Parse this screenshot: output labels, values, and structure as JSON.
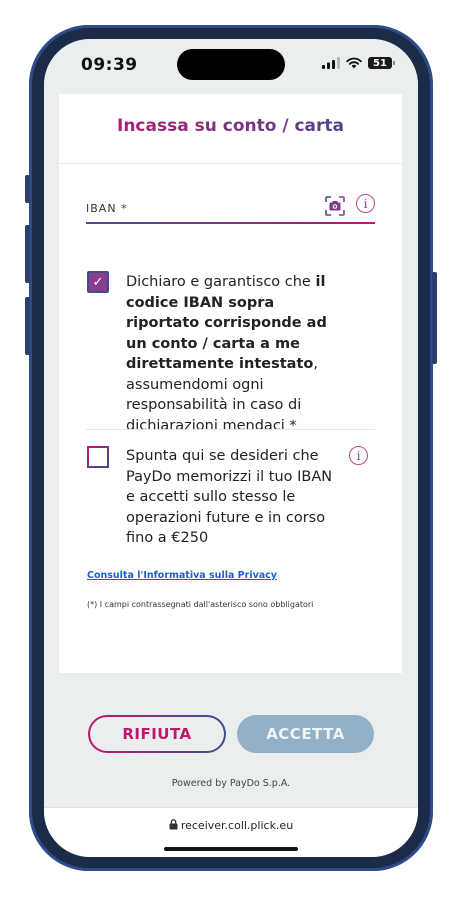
{
  "status_bar": {
    "time": "09:39",
    "battery": "51"
  },
  "page_title": "Incassa su conto / carta",
  "iban_field": {
    "label": "IBAN *",
    "value": ""
  },
  "declaration": {
    "checked": true,
    "part1": "Dichiaro e garantisco che ",
    "bold": "il codice IBAN sopra riportato corrisponde ad un conto / carta a me direttamente intestato",
    "part2": ", assumendomi ogni responsabilità in caso di dichiarazioni mendaci *"
  },
  "memorize": {
    "checked": false,
    "text": "Spunta qui se desideri che PayDo memorizzi il tuo IBAN e accetti sullo stesso le operazioni future e in corso fino a €250"
  },
  "privacy_link": "Consulta l'Informativa sulla Privacy",
  "footnote": "(*) I campi contrassegnati dall'asterisco sono obbligatori",
  "buttons": {
    "reject": "RIFIUTA",
    "accept": "ACCETTA"
  },
  "powered_by": "Powered by PayDo S.p.A.",
  "address_bar": {
    "url": "receiver.coll.plick.eu"
  },
  "colors": {
    "accent_magenta": "#c0166b",
    "accent_blue": "#3c4e91",
    "accept_disabled": "#93b0c7"
  }
}
